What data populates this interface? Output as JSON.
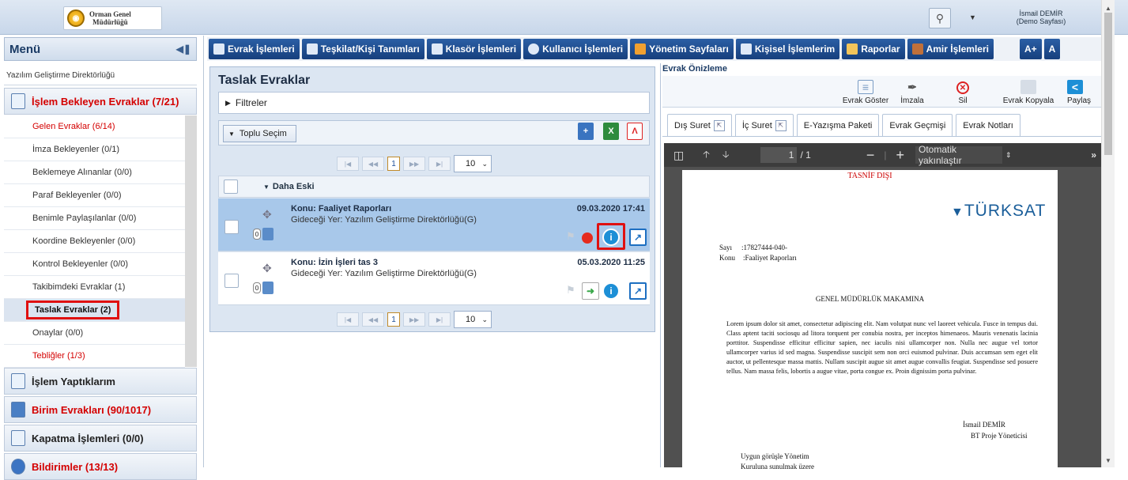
{
  "header": {
    "org_line1": "Orman Genel",
    "org_line2": "Müdürlüğü",
    "user_name": "İsmail DEMİR",
    "user_sub": "(Demo Sayfası)"
  },
  "menu": {
    "title": "Menü",
    "department": "Yazılım Geliştirme Direktörlüğü",
    "group_pending": "İşlem Bekleyen Evraklar (7/21)",
    "items": [
      {
        "label": "Gelen Evraklar (6/14)"
      },
      {
        "label": "İmza Bekleyenler (0/1)"
      },
      {
        "label": "Beklemeye Alınanlar (0/0)"
      },
      {
        "label": "Paraf Bekleyenler (0/0)"
      },
      {
        "label": "Benimle Paylaşılanlar (0/0)"
      },
      {
        "label": "Koordine Bekleyenler (0/0)"
      },
      {
        "label": "Kontrol Bekleyenler (0/0)"
      },
      {
        "label": "Takibimdeki Evraklar (1)"
      },
      {
        "label": "Taslak Evraklar (2)"
      },
      {
        "label": "Onaylar (0/0)"
      },
      {
        "label": "Tebliğler (1/3)"
      }
    ],
    "group_done": "İşlem Yaptıklarım",
    "group_unit": "Birim Evrakları (90/1017)",
    "group_close": "Kapatma İşlemleri (0/0)",
    "group_notify": "Bildirimler (13/13)"
  },
  "topnav": {
    "items": [
      "Evrak İşlemleri",
      "Teşkilat/Kişi Tanımları",
      "Klasör İşlemleri",
      "Kullanıcı İşlemleri",
      "Yönetim Sayfaları",
      "Kişisel İşlemlerim",
      "Raporlar",
      "Amir İşlemleri"
    ],
    "font_plus": "A+",
    "font_other": "A"
  },
  "drafts": {
    "title": "Taslak Evraklar",
    "filters": "Filtreler",
    "bulk_select": "Toplu Seçim",
    "page": "1",
    "page_size": "10",
    "group_label": "Daha Eski",
    "rows": [
      {
        "subject": "Konu: Faaliyet Raporları",
        "destination": "Gideceği Yer: Yazılım Geliştirme Direktörlüğü(G)",
        "date": "09.03.2020 17:41",
        "count": "0"
      },
      {
        "subject": "Konu: İzin İşleri tas 3",
        "destination": "Gideceği Yer: Yazılım Geliştirme Direktörlüğü(G)",
        "date": "05.03.2020 11:25",
        "count": "0"
      }
    ]
  },
  "preview": {
    "title": "Evrak Önizleme",
    "actions": [
      "Evrak Göster",
      "İmzala",
      "Sil",
      "Evrak Kopyala",
      "Paylaş"
    ],
    "tabs": [
      "Dış Suret",
      "İç Suret",
      "E-Yazışma Paketi",
      "Evrak Geçmişi",
      "Evrak Notları"
    ],
    "pdf_page": "1",
    "pdf_total": "/ 1",
    "pdf_zoom": "Otomatik yakınlaştır"
  },
  "document": {
    "classification": "TASNİF DIŞI",
    "brand": "TÜRKSAT",
    "sayi_label": "Sayı",
    "sayi_value": ":17827444-040-",
    "konu_label": "Konu",
    "konu_value": ":Faaliyet Raporları",
    "addressee": "GENEL MÜDÜRLÜK MAKAMINA",
    "body": "Lorem ipsum dolor sit amet, consectetur adipiscing elit. Nam volutpat nunc vel laoreet vehicula. Fusce in tempus dui. Class aptent taciti sociosqu ad litora torquent per conubia nostra, per inceptos himenaeos. Mauris venenatis lacinia porttitor. Suspendisse efficitur efficitur sapien, nec iaculis nisi ullamcorper non. Nulla nec augue vel tortor ullamcorper varius id sed magna. Suspendisse suscipit sem non orci euismod pulvinar. Duis accumsan sem eget elit auctor, ut pellentesque massa mattis. Nullam suscipit augue sit amet augue convallis feugiat. Suspendisse sed posuere tellus. Nam massa felis, lobortis a augue vitae, porta congue ex. Proin dignissim porta pulvinar.",
    "signer_name": "İsmail DEMİR",
    "signer_title": "BT Proje Yöneticisi",
    "footer1": "Uygun görüşle Yönetim",
    "footer2": "Kuruluna sunulmak üzere"
  }
}
